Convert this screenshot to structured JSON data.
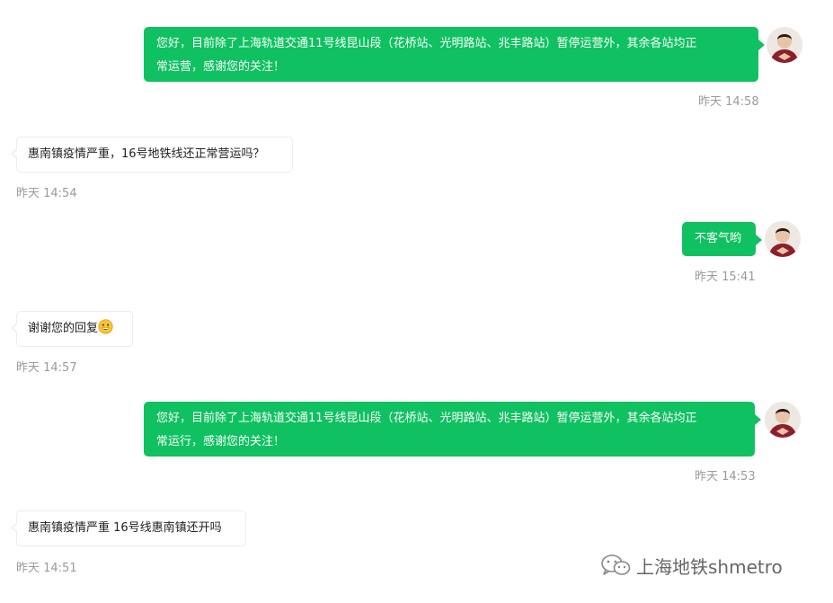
{
  "messages": [
    {
      "direction": "outgoing",
      "text": "您好，目前除了上海轨道交通11号线昆山段（花桥站、光明路站、兆丰路站）暂停运营外，其余各站均正\n常运营，感谢您的关注！",
      "time": "昨天 14:58"
    },
    {
      "direction": "incoming",
      "text": "惠南镇疫情严重，16号地铁线还正常营运吗？",
      "time": "昨天 14:54"
    },
    {
      "direction": "outgoing",
      "text": "不客气哟",
      "time": "昨天 15:41"
    },
    {
      "direction": "incoming",
      "text": "谢谢您的回复",
      "emoji": "grinning-face-emoji",
      "time": "昨天 14:57"
    },
    {
      "direction": "outgoing",
      "text": "您好，目前除了上海轨道交通11号线昆山段（花桥站、光明路站、兆丰路站）暂停运营外，其余各站均正\n常运行，感谢您的关注！",
      "time": "昨天 14:53"
    },
    {
      "direction": "incoming",
      "text": "惠南镇疫情严重 16号线惠南镇还开吗",
      "time": "昨天 14:51"
    }
  ],
  "avatar_icon": "user-avatar-icon",
  "watermark": {
    "icon": "wechat-icon",
    "text": "上海地铁shmetro"
  },
  "colors": {
    "outgoing_bubble": "#0fc160",
    "incoming_bubble": "#ffffff",
    "timestamp": "#9a9a9a",
    "background": "#ffffff"
  }
}
